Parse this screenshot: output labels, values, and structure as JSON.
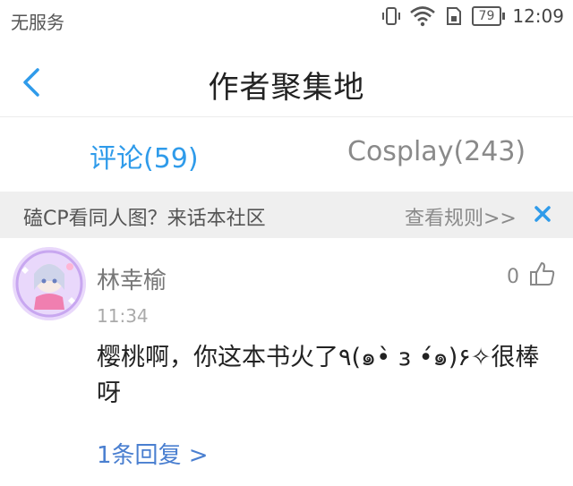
{
  "status_bar": {
    "carrier": "无服务",
    "battery": "79",
    "time": "12:09"
  },
  "header": {
    "title": "作者聚集地"
  },
  "tabs": [
    {
      "label": "评论(59)",
      "active": true
    },
    {
      "label": "Cosplay(243)",
      "active": false
    }
  ],
  "banner": {
    "text": "磕CP看同人图？来话本社区",
    "link": "查看规则>>"
  },
  "comment": {
    "username": "林幸榆",
    "time": "11:34",
    "text": "樱桃啊，你这本书火了٩(๑•̀ з •́๑)۶✧很棒呀",
    "likes": "0",
    "replies": "1条回复 >"
  },
  "colors": {
    "accent": "#2f9bea",
    "link": "#4a7fd0",
    "banner_bg": "#efefef"
  }
}
